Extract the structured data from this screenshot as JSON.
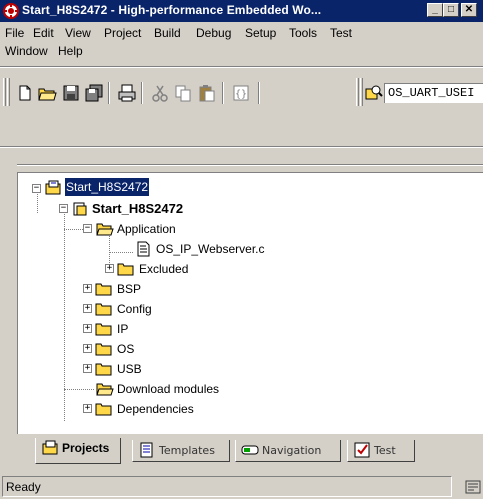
{
  "window": {
    "title": "Start_H8S2472 - High-performance Embedded Wo...",
    "min_glyph": "_",
    "max_glyph": "□",
    "close_glyph": "✕"
  },
  "menu": {
    "items": [
      "File",
      "Edit",
      "View",
      "Project",
      "Build",
      "Debug",
      "Setup",
      "Tools",
      "Test",
      "Window",
      "Help"
    ]
  },
  "toolbar": {
    "combo_value": "OS_UART_USEI"
  },
  "tree": {
    "root": "Start_H8S2472",
    "project": "Start_H8S2472",
    "nodes": {
      "application": "Application",
      "webserver": "OS_IP_Webserver.c",
      "excluded": "Excluded",
      "bsp": "BSP",
      "config": "Config",
      "ip": "IP",
      "os": "OS",
      "usb": "USB",
      "download": "Download modules",
      "dependencies": "Dependencies"
    }
  },
  "tabs": {
    "projects": "Projects",
    "templates": "Templates",
    "navigation": "Navigation",
    "test": "Test"
  },
  "status": {
    "text": "Ready"
  },
  "colors": {
    "titlebar": "#0a246a",
    "selection": "#0a246a",
    "face": "#d4d0c8",
    "folder": "#ffd84a"
  }
}
